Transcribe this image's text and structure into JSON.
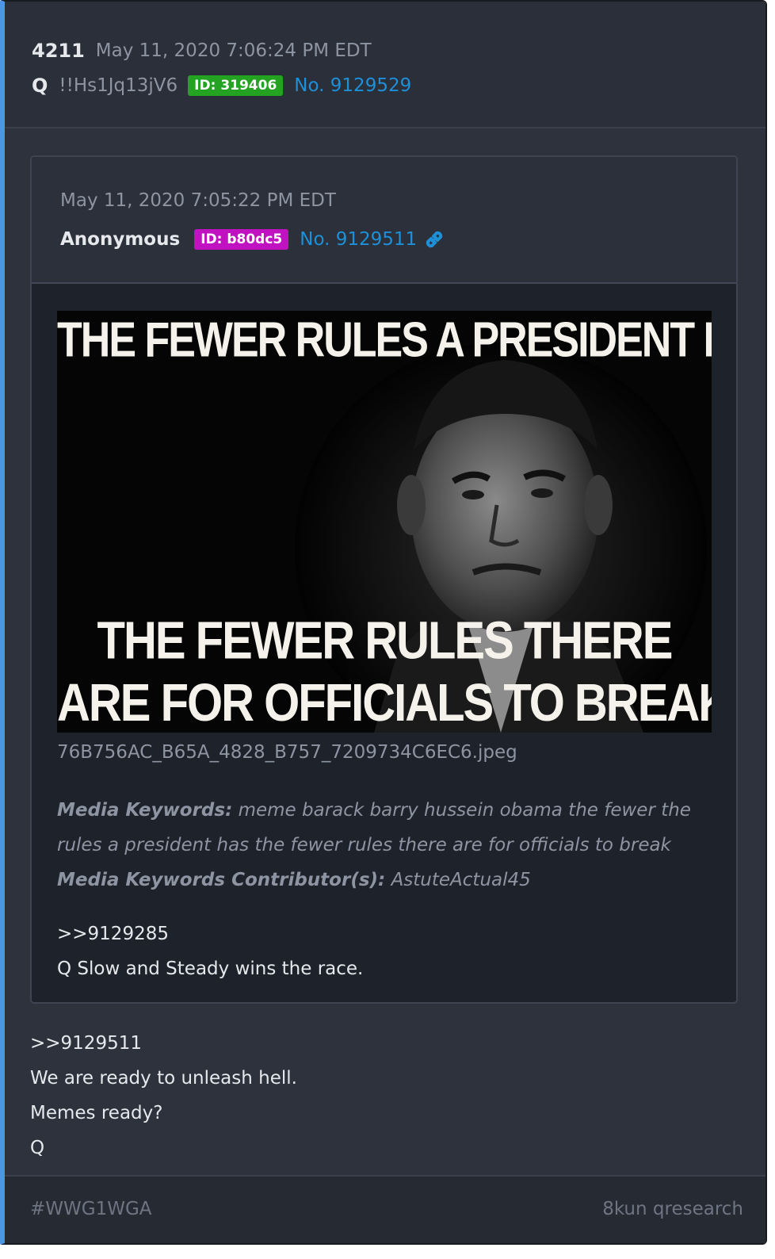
{
  "post": {
    "number": "4211",
    "date": "May 11, 2020 7:06:24 PM EDT",
    "name": "Q",
    "tripcode": "!!Hs1Jq13jV6",
    "id_badge": "ID: 319406",
    "post_no": "No. 9129529",
    "body": [
      ">>9129511",
      "We are ready to unleash hell.",
      "Memes ready?",
      "Q"
    ]
  },
  "quoted": {
    "date": "May 11, 2020 7:05:22 PM EDT",
    "name": "Anonymous",
    "id_badge": "ID: b80dc5",
    "post_no": "No. 9129511",
    "image": {
      "top_text": "THE FEWER RULES A PRESIDENT HAS,",
      "bottom_text_1": "THE FEWER RULES THERE",
      "bottom_text_2": "ARE FOR OFFICIALS TO BREAK."
    },
    "filename": "76B756AC_B65A_4828_B757_7209734C6EC6.jpeg",
    "keywords_label": "Media Keywords:",
    "keywords": "meme barack barry hussein obama the fewer the rules a president has the fewer rules there are for officials to break",
    "contributors_label": "Media Keywords Contributor(s):",
    "contributors": "AstuteActual45",
    "body": [
      ">>9129285",
      "Q Slow and Steady wins the race."
    ]
  },
  "footer": {
    "hashtag": "#WWG1WGA",
    "source": "8kun qresearch"
  },
  "colors": {
    "accent_border": "#4f95e6",
    "id_badge_q": "#23a321",
    "id_badge_anon": "#c112c1",
    "link": "#1e90d8"
  }
}
